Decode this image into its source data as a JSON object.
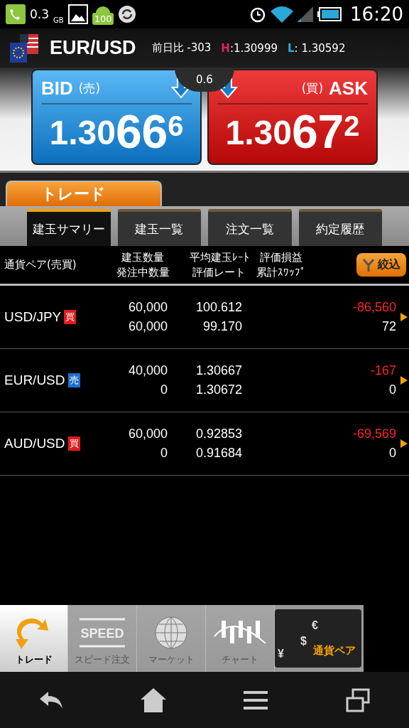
{
  "status_bar": {
    "data_usage": "0.3",
    "data_unit": "GB",
    "battery_badge": "100",
    "time": "16:20"
  },
  "header": {
    "pair": "EUR/USD",
    "change_label": "前日比",
    "change": "-303",
    "high_label": "H",
    "separator": ":",
    "high": "1.30999",
    "low_label": "L",
    "low": "1.30592"
  },
  "quotes": {
    "spread": "0.6",
    "bid": {
      "label": "BID",
      "side": "(売)",
      "price_main": "1.30",
      "price_big": "66",
      "price_small": "6"
    },
    "ask": {
      "label": "ASK",
      "side": "(買)",
      "price_main": "1.30",
      "price_big": "67",
      "price_small": "2"
    }
  },
  "section_tab": "トレード",
  "tabs": [
    {
      "label": "建玉サマリー",
      "selected": true
    },
    {
      "label": "建玉一覧",
      "selected": false
    },
    {
      "label": "注文一覧",
      "selected": false
    },
    {
      "label": "約定履歴",
      "selected": false
    }
  ],
  "columns": [
    [
      "通貨ペア(売買)"
    ],
    [
      "建玉数量",
      "発注中数量"
    ],
    [
      "平均建玉ﾚｰﾄ",
      "評価レート"
    ],
    [
      "評価損益",
      "累計ｽﾜｯﾌﾟ"
    ]
  ],
  "filter_button": "絞込",
  "rows": [
    {
      "pair": "USD/JPY",
      "side": "買",
      "kind": "buy",
      "quantity": "60,000",
      "pending": "60,000",
      "avg_rate": "100.612",
      "eval_rate": "99.170",
      "pl": "-86,560",
      "swap": "72"
    },
    {
      "pair": "EUR/USD",
      "side": "売",
      "kind": "sell",
      "quantity": "40,000",
      "pending": "0",
      "avg_rate": "1.30667",
      "eval_rate": "1.30672",
      "pl": "-167",
      "swap": "0"
    },
    {
      "pair": "AUD/USD",
      "side": "買",
      "kind": "buy",
      "quantity": "60,000",
      "pending": "0",
      "avg_rate": "0.92853",
      "eval_rate": "0.91684",
      "pl": "-69,569",
      "swap": "0"
    }
  ],
  "bottom_nav": [
    {
      "kind": "trade",
      "label": "トレード",
      "selected": true
    },
    {
      "kind": "speed",
      "label": "スピード注文",
      "icon_text": "SPEED",
      "selected": false
    },
    {
      "kind": "market",
      "label": "マーケット",
      "selected": false
    },
    {
      "kind": "chart",
      "label": "チャート",
      "selected": false
    },
    {
      "kind": "banner",
      "label": "通貨ペア",
      "symbols": [
        "¥",
        "$",
        "€"
      ],
      "selected": false
    }
  ]
}
